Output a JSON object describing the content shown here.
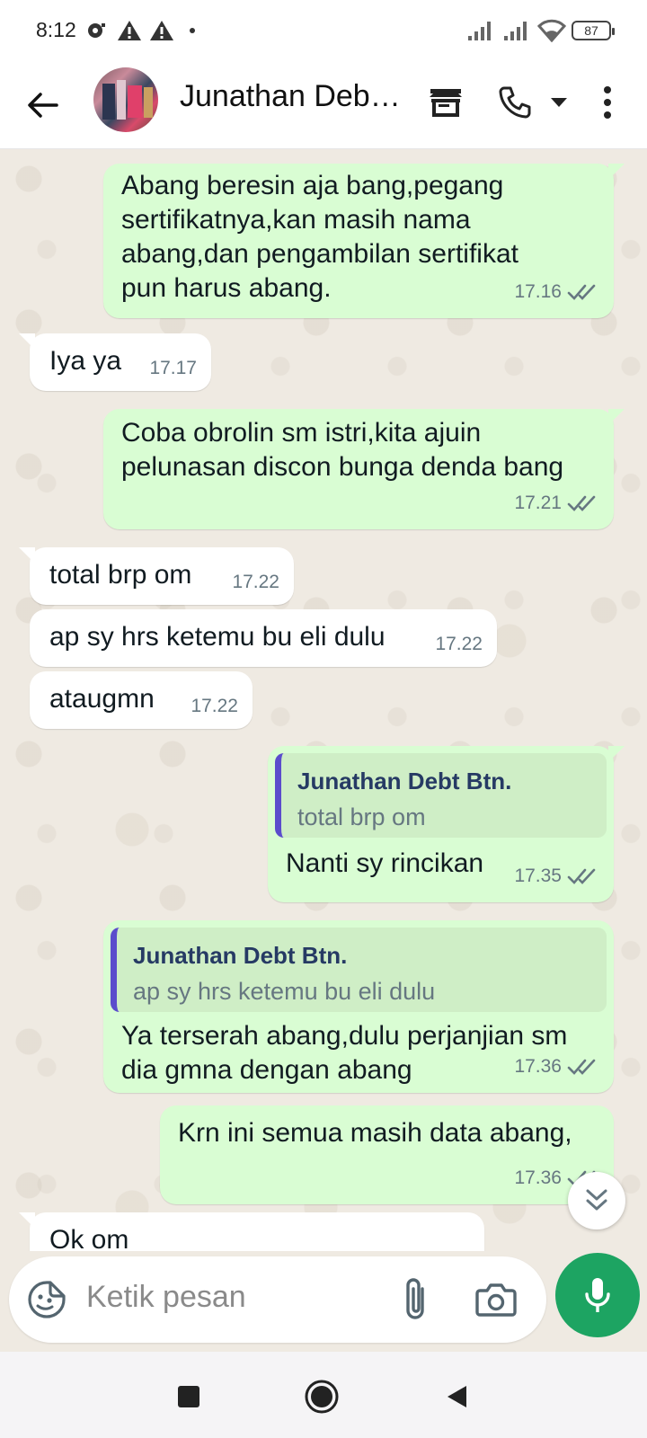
{
  "status_bar": {
    "time": "8:12",
    "battery": "87"
  },
  "header": {
    "contact_name": "Junathan Debt Btn."
  },
  "messages": [
    {
      "dir": "out",
      "text": "Abang beresin aja bang,pegang sertifikatnya,kan masih nama abang,dan pengambilan sertifikat pun harus abang.",
      "time": "17.16"
    },
    {
      "dir": "in",
      "text": "Iya ya",
      "time": "17.17"
    },
    {
      "dir": "out",
      "text": "Coba obrolin sm istri,kita ajuin pelunasan discon bunga denda bang",
      "time": "17.21"
    },
    {
      "dir": "in",
      "text": "total brp om",
      "time": "17.22"
    },
    {
      "dir": "in",
      "text": "ap sy hrs ketemu bu eli dulu",
      "time": "17.22"
    },
    {
      "dir": "in",
      "text": "ataugmn",
      "time": "17.22"
    },
    {
      "dir": "out",
      "text": "Nanti sy rincikan",
      "time": "17.35",
      "reply_name": "Junathan Debt Btn.",
      "reply_text": "total brp om"
    },
    {
      "dir": "out",
      "text": "Ya terserah abang,dulu perjanjian sm dia gmna dengan abang",
      "time": "17.36",
      "reply_name": "Junathan Debt Btn.",
      "reply_text": "ap sy hrs ketemu bu eli dulu"
    },
    {
      "dir": "out",
      "text": "Krn ini semua masih data abang,",
      "time": "17.36"
    },
    {
      "dir": "in",
      "text": "Ok om",
      "time": ""
    }
  ],
  "composer": {
    "placeholder": "Ketik pesan"
  },
  "colors": {
    "outgoing_bubble": "#d9fdd3",
    "incoming_bubble": "#ffffff",
    "accent": "#1da462",
    "reply_bar": "#5b4ccc"
  },
  "icons": [
    "back-arrow-icon",
    "shop-icon",
    "phone-icon",
    "dropdown-icon",
    "more-vert-icon",
    "sticker-icon",
    "attach-icon",
    "camera-icon",
    "mic-icon",
    "double-chevron-down-icon",
    "ticks-icon"
  ]
}
